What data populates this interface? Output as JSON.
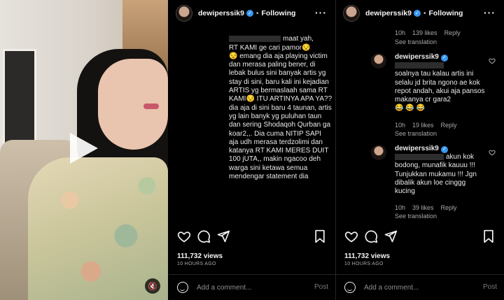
{
  "video": {
    "play_icon": "play-icon",
    "mute_icon": "speaker-mute-icon"
  },
  "post1": {
    "username": "dewiperssik9",
    "follow_label": "Following",
    "comment_text": "maat yah,\nRT KAMI ge cari pamor😒\n😒 emang dia aja playing victim dan merasa paling bener, di lebak bulus sini banyak artis yg stay di sini, baru kali ini kejadian ARTIS yg bermaslaah sama RT KAMI😒 ITU ARTINYA APA YA?? dia aja di sini baru 4 taunan, artis yg lain banyk yg puluhan taun dan sering Shodaqoh Qurban ga koar2,,. Dia cuma NITIP SAPI aja udh merasa terdzolimi dan katanya RT KAMI MERES DUIT 100 jUTA,, makin ngacoo deh warga sini ketawa semua mendengar statement dia",
    "views": "111,732 views",
    "time_ago": "10 HOURS AGO",
    "add_comment_placeholder": "Add a comment...",
    "post_label": "Post"
  },
  "post2": {
    "username": "dewiperssik9",
    "follow_label": "Following",
    "top_meta": {
      "time": "10h",
      "likes": "139 likes",
      "reply": "Reply"
    },
    "top_see_translation": "See translation",
    "comments": [
      {
        "user": "dewiperssik9",
        "text": "soalnya tau kalau artis ini selalu jd brita ngono ae kok repot andah, akui aja pansos makanya cr gara2\n😂 😂 😂",
        "time": "10h",
        "likes": "19 likes",
        "reply": "Reply",
        "see_translation": "See translation"
      },
      {
        "user": "dewiperssik9",
        "text": "akun kok bodong, munafik kauuu !!! Tunjukkan mukamu !!! Jgn dibalik akun loe cinggg kucing",
        "time": "10h",
        "likes": "39 likes",
        "reply": "Reply",
        "see_translation": "See translation"
      }
    ],
    "views": "111,732 views",
    "time_ago": "10 HOURS AGO",
    "add_comment_placeholder": "Add a comment...",
    "post_label": "Post"
  },
  "colors": {
    "background": "#000000",
    "text": "#f5f5f5",
    "muted": "#a8a8a8",
    "verified": "#3897f0"
  }
}
